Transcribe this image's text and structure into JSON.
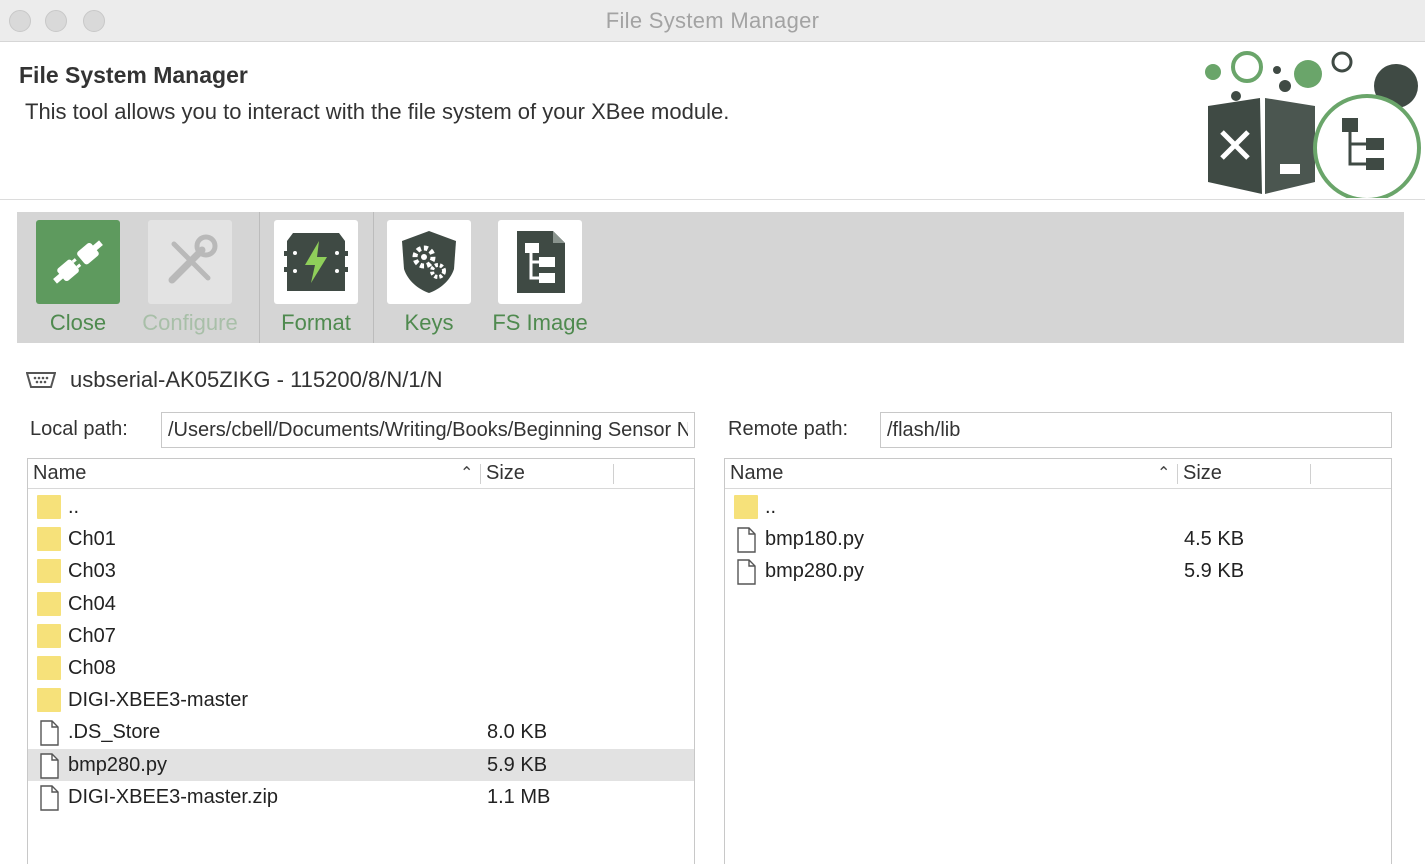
{
  "window": {
    "title": "File System Manager"
  },
  "header": {
    "title": "File System Manager",
    "description": "This tool allows you to interact with the file system of your XBee module."
  },
  "toolbar": {
    "buttons": [
      {
        "label": "Close",
        "icon": "plug-icon",
        "enabled": true,
        "active": true
      },
      {
        "label": "Configure",
        "icon": "wrench-screwdriver-icon",
        "enabled": false
      },
      {
        "label": "Format",
        "icon": "format-chip-icon",
        "enabled": true
      },
      {
        "label": "Keys",
        "icon": "shield-gear-icon",
        "enabled": true
      },
      {
        "label": "FS Image",
        "icon": "fs-image-icon",
        "enabled": true
      }
    ]
  },
  "connection": {
    "text": "usbserial-AK05ZIKG - 115200/8/N/1/N",
    "icon": "serial-port-icon"
  },
  "local": {
    "path_label": "Local path:",
    "path_value": "/Users/cbell/Documents/Writing/Books/Beginning Sensor Networks",
    "columns": {
      "name": "Name",
      "size": "Size"
    },
    "items": [
      {
        "name": "..",
        "size": "",
        "type": "folder"
      },
      {
        "name": "Ch01",
        "size": "",
        "type": "folder"
      },
      {
        "name": "Ch03",
        "size": "",
        "type": "folder"
      },
      {
        "name": "Ch04",
        "size": "",
        "type": "folder"
      },
      {
        "name": "Ch07",
        "size": "",
        "type": "folder"
      },
      {
        "name": "Ch08",
        "size": "",
        "type": "folder"
      },
      {
        "name": "DIGI-XBEE3-master",
        "size": "",
        "type": "folder"
      },
      {
        "name": ".DS_Store",
        "size": "8.0 KB",
        "type": "file"
      },
      {
        "name": "bmp280.py",
        "size": "5.9 KB",
        "type": "file",
        "selected": true
      },
      {
        "name": "DIGI-XBEE3-master.zip",
        "size": "1.1 MB",
        "type": "file"
      }
    ]
  },
  "remote": {
    "path_label": "Remote path:",
    "path_value": "/flash/lib",
    "columns": {
      "name": "Name",
      "size": "Size"
    },
    "items": [
      {
        "name": "..",
        "size": "",
        "type": "folder"
      },
      {
        "name": "bmp180.py",
        "size": "4.5 KB",
        "type": "file"
      },
      {
        "name": "bmp280.py",
        "size": "5.9 KB",
        "type": "file"
      }
    ]
  },
  "colors": {
    "accent_green": "#5e9a5e",
    "icon_dark": "#3f4a44",
    "folder_yellow": "#f6e17a",
    "toolbar_bg": "#d5d5d5"
  }
}
